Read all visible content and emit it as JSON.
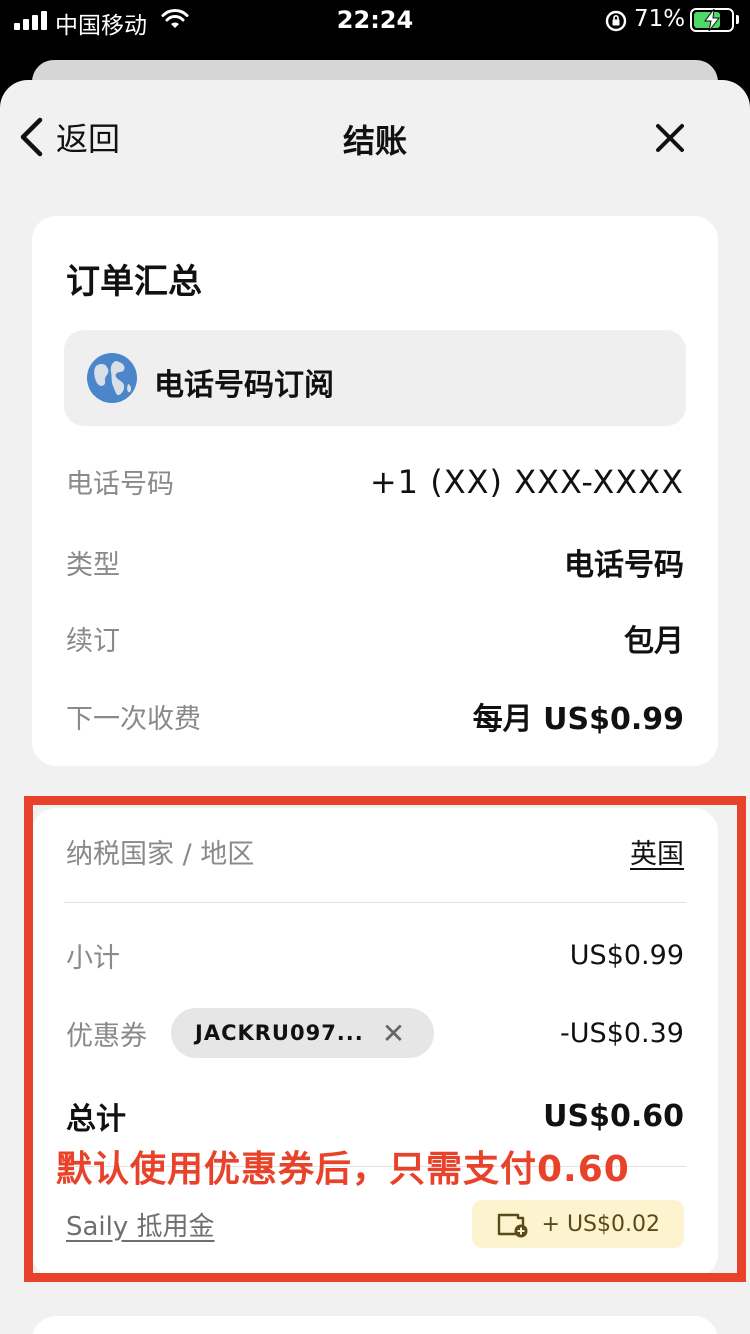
{
  "status_bar": {
    "carrier": "中国移动",
    "time": "22:24",
    "battery_percent": "71%",
    "battery_level": 0.71
  },
  "nav": {
    "back_label": "返回",
    "title": "结账"
  },
  "order": {
    "title": "订单汇总",
    "product_name": "电话号码订阅",
    "rows": [
      {
        "label": "电话号码",
        "value": "+1 (XX) XXX-XXXX"
      },
      {
        "label": "类型",
        "value": "电话号码"
      },
      {
        "label": "续订",
        "value": "包月"
      },
      {
        "label": "下一次收费",
        "value": "每月 US$0.99"
      }
    ]
  },
  "summary": {
    "tax_label": "纳税国家 / 地区",
    "tax_country": "英国",
    "subtotal_label": "小计",
    "subtotal_value": "US$0.99",
    "coupon_label": "优惠券",
    "coupon_code": "JACKRU097...",
    "coupon_value": "-US$0.39",
    "total_label": "总计",
    "total_value": "US$0.60",
    "credit_label": "Saily 抵用金",
    "credit_value": "+ US$0.02"
  },
  "annotation": "默认使用优惠券后，只需支付0.60",
  "colors": {
    "accent_red": "#e8432a",
    "credit_bg": "#fdf3cf"
  }
}
